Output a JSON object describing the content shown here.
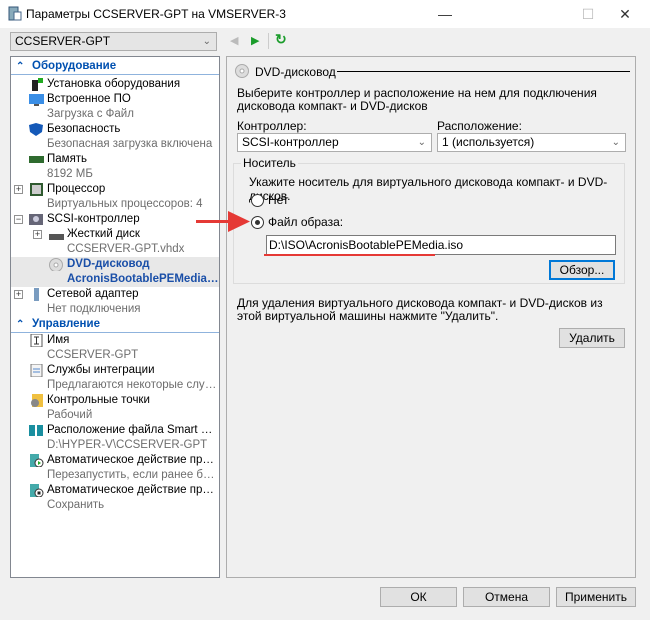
{
  "window": {
    "title": "Параметры CCSERVER-GPT на VMSERVER-3",
    "minimize": "—",
    "maximize": "☐",
    "close": "✕"
  },
  "toolbar": {
    "vm_select": "CCSERVER-GPT"
  },
  "tree": {
    "hardware_header": "Оборудование",
    "hardware": [
      {
        "label": "Установка оборудования",
        "sub": ""
      },
      {
        "label": "Встроенное ПО",
        "sub": "Загрузка с Файл"
      },
      {
        "label": "Безопасность",
        "sub": "Безопасная загрузка включена"
      },
      {
        "label": "Память",
        "sub": "8192 МБ"
      },
      {
        "label": "Процессор",
        "sub": "Виртуальных процессоров: 4"
      },
      {
        "label": "SCSI-контроллер",
        "sub": ""
      },
      {
        "label": "Жесткий диск",
        "sub": "CCSERVER-GPT.vhdx"
      },
      {
        "label": "DVD-дисковод",
        "sub": "AcronisBootablePEMedia.iso"
      },
      {
        "label": "Сетевой адаптер",
        "sub": "Нет подключения"
      }
    ],
    "management_header": "Управление",
    "management": [
      {
        "label": "Имя",
        "sub": "CCSERVER-GPT"
      },
      {
        "label": "Службы интеграции",
        "sub": "Предлагаются некоторые службы"
      },
      {
        "label": "Контрольные точки",
        "sub": "Рабочий"
      },
      {
        "label": "Расположение файла Smart Paging",
        "sub": "D:\\HYPER-V\\CCSERVER-GPT"
      },
      {
        "label": "Автоматическое действие при за...",
        "sub": "Перезапустить, если ранее был ..."
      },
      {
        "label": "Автоматическое действие при за...",
        "sub": "Сохранить"
      }
    ]
  },
  "panel": {
    "title": "DVD-дисковод",
    "intro": "Выберите контроллер и расположение на нем для подключения дисковода компакт- и DVD-дисков",
    "controller_label": "Контроллер:",
    "controller_value": "SCSI-контроллер",
    "location_label": "Расположение:",
    "location_value": "1 (используется)",
    "media_group": "Носитель",
    "media_hint": "Укажите носитель для виртуального дисковода компакт- и DVD-дисков.",
    "radio_none": "Нет",
    "radio_image": "Файл образа:",
    "image_path": "D:\\ISO\\AcronisBootablePEMedia.iso",
    "browse": "Обзор...",
    "remove_hint": "Для удаления виртуального дисковода компакт- и DVD-дисков из этой виртуальной машины нажмите \"Удалить\".",
    "remove": "Удалить"
  },
  "footer": {
    "ok": "ОК",
    "cancel": "Отмена",
    "apply": "Применить"
  },
  "colors": {
    "accent": "#0078d7",
    "annotation": "#e53935"
  }
}
